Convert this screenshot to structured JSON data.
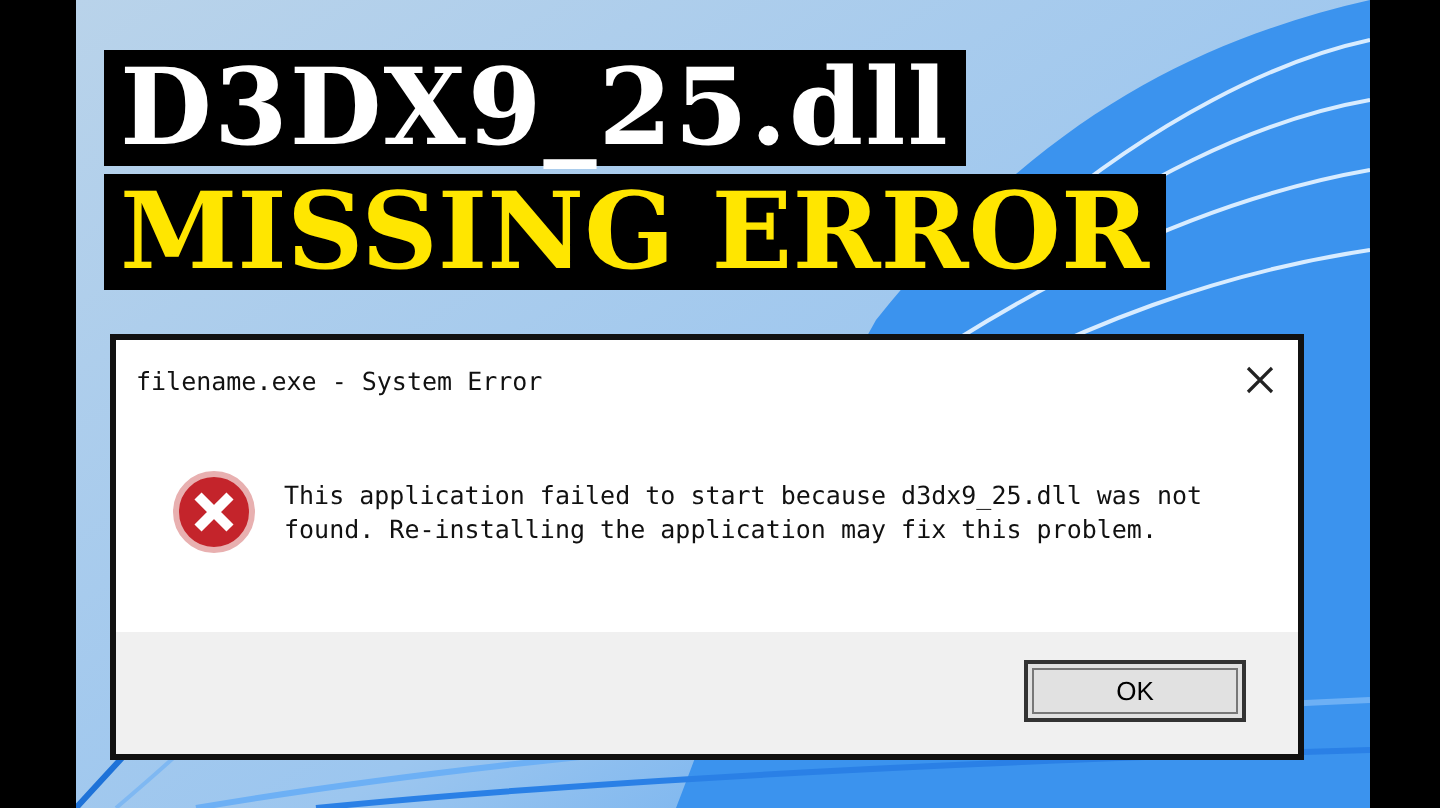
{
  "headline": [
    "D3DX9_25.dll",
    "MISSING ERROR"
  ],
  "dialog": {
    "title": "filename.exe - System Error",
    "message": "This application failed to start because d3dx9_25.dll was not found. Re-installing the application may fix this problem.",
    "buttons": [
      "OK"
    ]
  }
}
